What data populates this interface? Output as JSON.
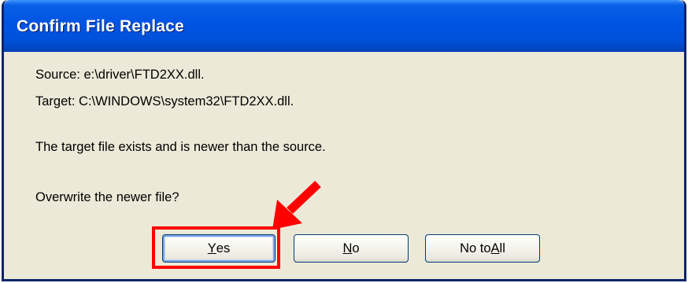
{
  "dialog": {
    "title": "Confirm File Replace",
    "source_line": "Source: e:\\driver\\FTD2XX.dll.",
    "target_line": "Target: C:\\WINDOWS\\system32\\FTD2XX.dll.",
    "message": "The target file exists and is newer than the source.",
    "question": "Overwrite the newer file?"
  },
  "buttons": {
    "yes": {
      "prefix": "",
      "mnemonic": "Y",
      "suffix": "es"
    },
    "no": {
      "prefix": "",
      "mnemonic": "N",
      "suffix": "o"
    },
    "no_to_all": {
      "prefix": "No to ",
      "mnemonic": "A",
      "suffix": "ll"
    }
  },
  "annotation": {
    "highlight_color": "#ff0000",
    "arrow_color": "#ff0000",
    "target": "yes-button"
  }
}
